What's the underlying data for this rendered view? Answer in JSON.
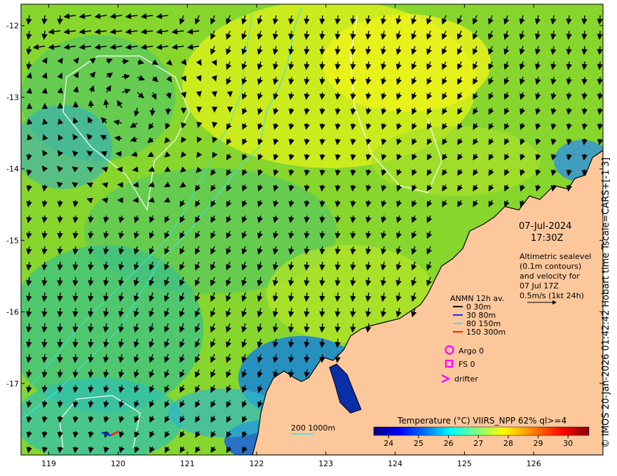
{
  "map": {
    "lon_ticks": [
      "119",
      "120",
      "121",
      "122",
      "123",
      "124",
      "125",
      "126"
    ],
    "lat_ticks": [
      "-12",
      "-13",
      "-14",
      "-15",
      "-16",
      "-17"
    ],
    "lon_range": [
      118.6,
      127.0
    ],
    "lat_range": [
      -18.0,
      -11.7
    ],
    "sea_color": "#7ed321",
    "land_color": "#fcc89b",
    "credit": "© IMOS 20-Jan-2026 01:42:42 Hobart time Tscale=CARS+[-1 3]"
  },
  "info": {
    "date": "07-Jul-2024",
    "time": "17:30Z",
    "alti_lines": [
      "Altimetric sealevel",
      "(0.1m contours)",
      "and velocity for",
      "07 Jul 17Z",
      "0.5m/s (1kt 24h)"
    ]
  },
  "legend": {
    "title": "ANMN 12h av.",
    "items": [
      {
        "label": "0 30m",
        "color": "#000000"
      },
      {
        "label": "30 80m",
        "color": "#1030ff"
      },
      {
        "label": "80 150m",
        "color": "#40e0ff"
      },
      {
        "label": "150 300m",
        "color": "#ff2000"
      }
    ],
    "argo": "Argo 0",
    "fs": "FS 0",
    "drifter": "drifter",
    "marker_color": "#ff00ff"
  },
  "bathy": {
    "label": "200 1000m",
    "color": "#40e0e0"
  },
  "colorbar": {
    "title": "Temperature (°C) VIIRS_NPP 62% ql>=4",
    "ticks": [
      "24",
      "25",
      "26",
      "27",
      "28",
      "29",
      "30"
    ],
    "range": [
      23.5,
      30.7
    ],
    "colors": [
      "#000080",
      "#0000ff",
      "#0080ff",
      "#00ffff",
      "#80ff80",
      "#ffff00",
      "#ff8000",
      "#ff0000",
      "#800000"
    ]
  }
}
